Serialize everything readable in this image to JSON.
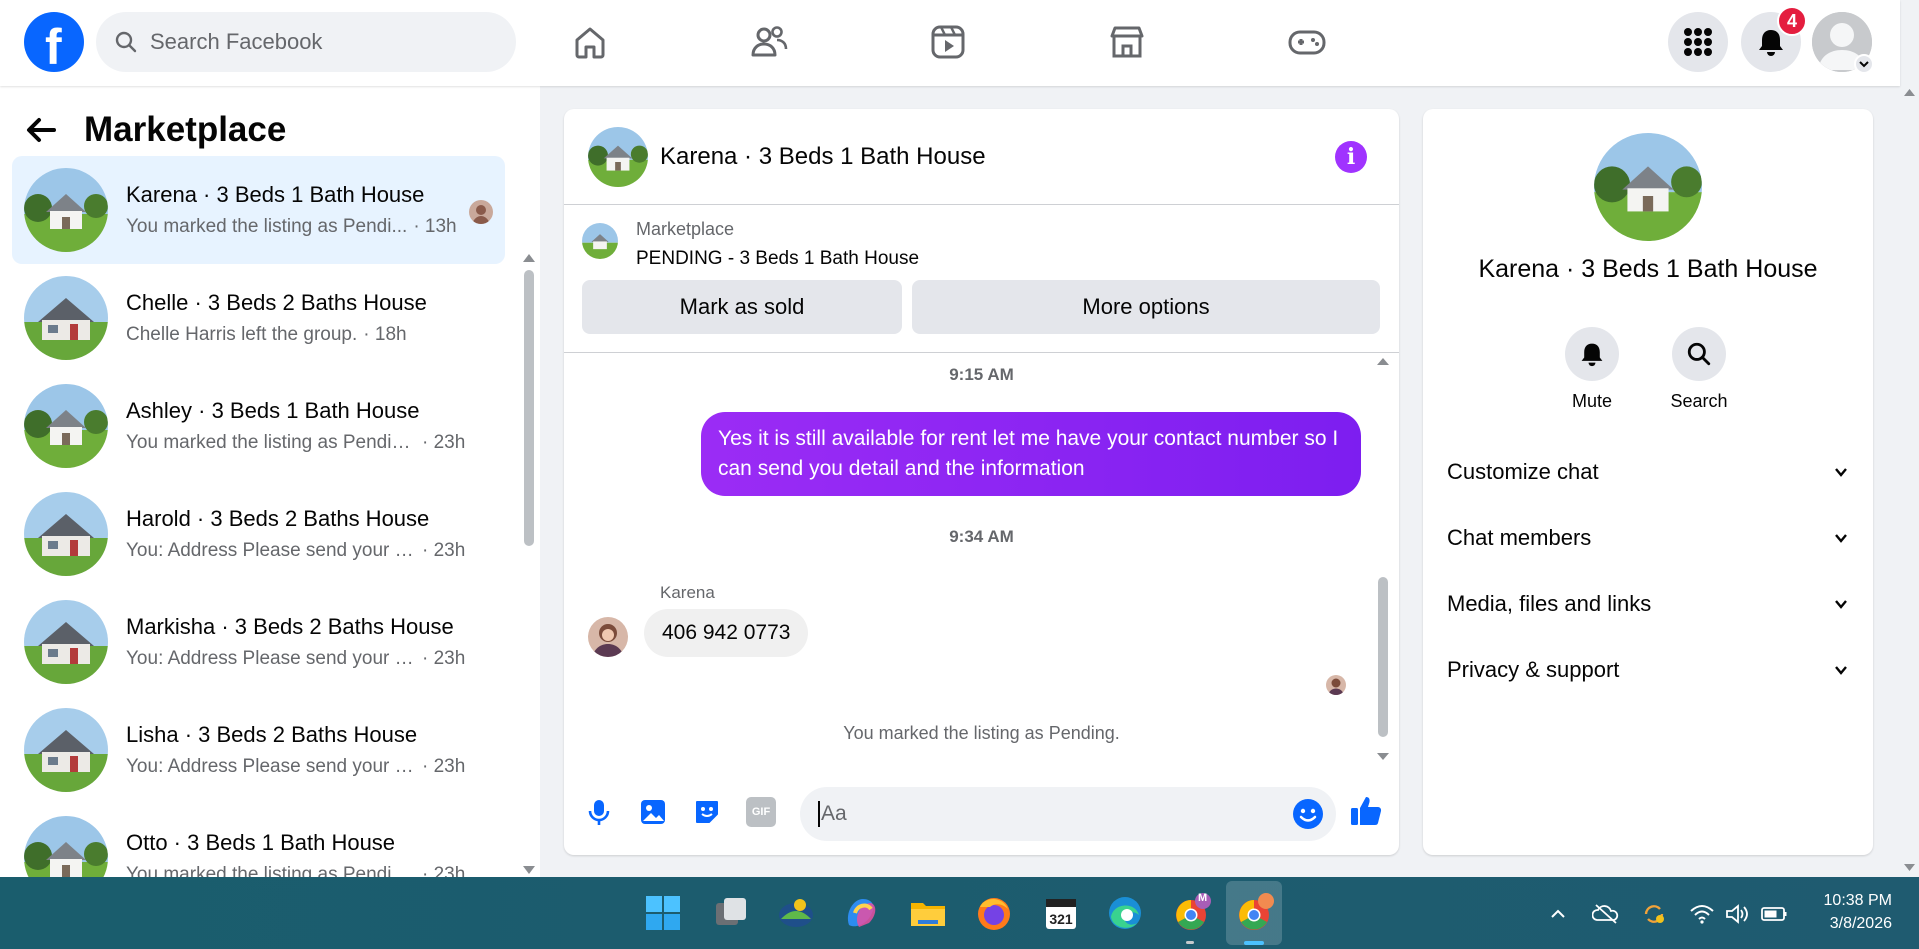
{
  "topbar": {
    "logo": "f",
    "search_placeholder": "Search Facebook",
    "notification_count": "4",
    "nav_icons": [
      "home-icon",
      "friends-icon",
      "video-icon",
      "marketplace-icon",
      "gaming-icon"
    ]
  },
  "left": {
    "title": "Marketplace",
    "conversations": [
      {
        "title": "Karena · 3 Beds 1 Bath House",
        "message": "You marked the listing as Pendi...",
        "time": "· 13h"
      },
      {
        "title": "Chelle · 3 Beds 2 Baths House",
        "message": "Chelle Harris left the group.",
        "time": "· 18h"
      },
      {
        "title": "Ashley · 3 Beds 1 Bath House",
        "message": "You marked the listing as Pending.",
        "time": "· 23h"
      },
      {
        "title": "Harold · 3 Beds 2 Baths House",
        "message": "You: Address Please send your ph...",
        "time": "· 23h"
      },
      {
        "title": "Markisha · 3 Beds 2 Baths House",
        "message": "You: Address Please send your ph...",
        "time": "· 23h"
      },
      {
        "title": "Lisha · 3 Beds 2 Baths House",
        "message": "You: Address Please send your ph...",
        "time": "· 23h"
      },
      {
        "title": "Otto · 3 Beds 1 Bath House",
        "message": "You marked the listing as Pending.",
        "time": "· 23h"
      }
    ]
  },
  "chat": {
    "title": "Karena · 3 Beds 1 Bath House",
    "info_glyph": "i",
    "listing_label": "Marketplace",
    "listing_title": "PENDING - 3 Beds 1 Bath House",
    "mark_sold": "Mark as sold",
    "more_options": "More options",
    "time1": "9:15 AM",
    "outgoing_message": "Yes it is still available for rent let me have your contact number so I can send you detail and the information",
    "time2": "9:34 AM",
    "sender_name": "Karena",
    "incoming_message": "406 942 0773",
    "system_message": "You marked the listing as Pending.",
    "composer_placeholder": "Aa",
    "gif_label": "GIF"
  },
  "right": {
    "name": "Karena · 3 Beds 1 Bath House",
    "mute_label": "Mute",
    "search_label": "Search",
    "sections": [
      "Customize chat",
      "Chat members",
      "Media, files and links",
      "Privacy & support"
    ]
  },
  "taskbar": {
    "time": "10:38 PM",
    "date": "3/8/2026",
    "badge_m": "M"
  },
  "colors": {
    "facebook_blue": "#0866ff",
    "message_purple": "#8a2be2",
    "active_item": "#e7f3ff",
    "badge_red": "#e41e3f",
    "taskbar": "#1d5a6b"
  }
}
